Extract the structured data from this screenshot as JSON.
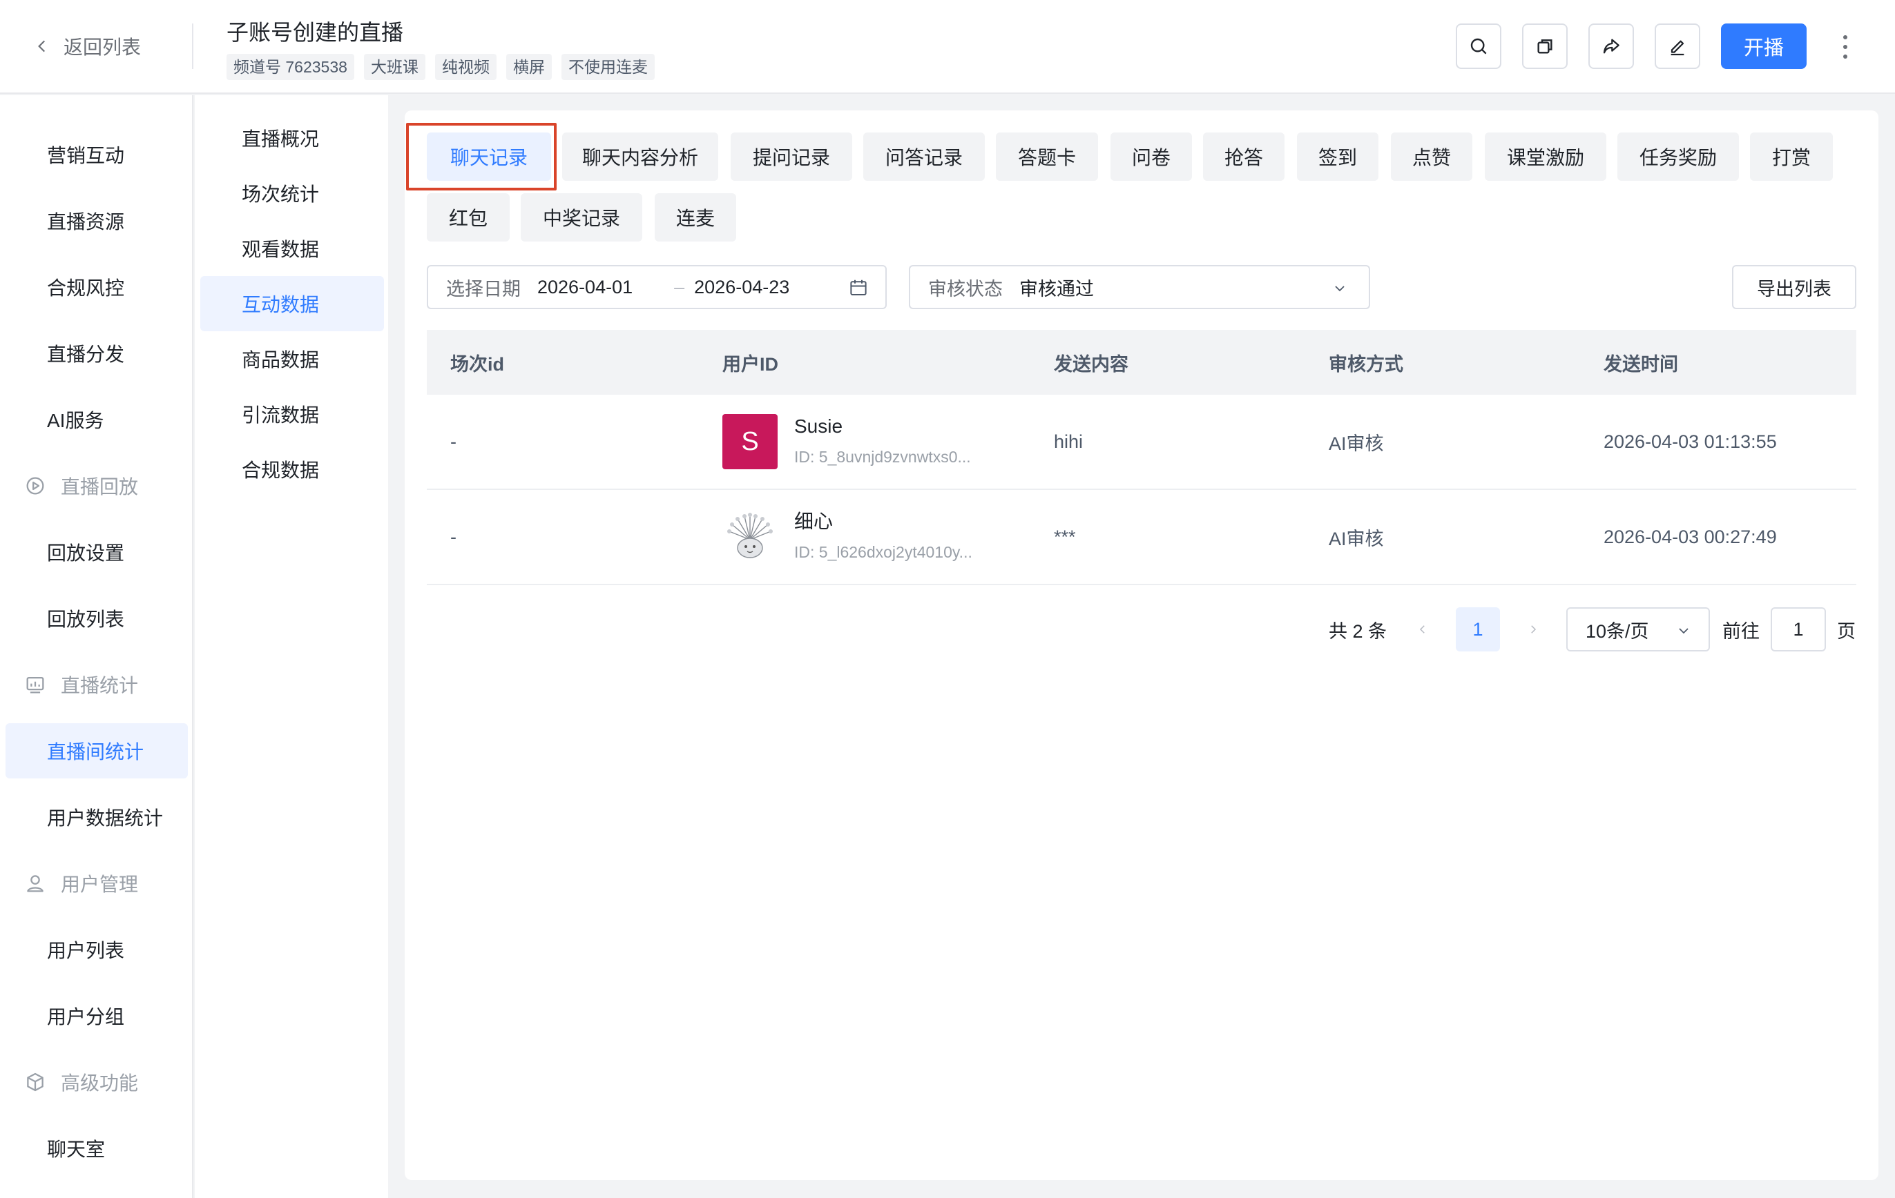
{
  "header": {
    "back_label": "返回列表",
    "title": "子账号创建的直播",
    "tags": [
      "频道号 7623538",
      "大班课",
      "纯视频",
      "横屏",
      "不使用连麦"
    ],
    "icons": [
      "search-icon",
      "copy-icon",
      "share-icon",
      "edit-icon"
    ],
    "live_button": "开播",
    "accent_color": "#2f7bff"
  },
  "nav_primary": {
    "items": [
      {
        "label": "营销互动",
        "kind": "item"
      },
      {
        "label": "直播资源",
        "kind": "item"
      },
      {
        "label": "合规风控",
        "kind": "item"
      },
      {
        "label": "直播分发",
        "kind": "item"
      },
      {
        "label": "AI服务",
        "kind": "item"
      },
      {
        "label": "直播回放",
        "kind": "group",
        "icon": "replay-icon"
      },
      {
        "label": "回放设置",
        "kind": "item"
      },
      {
        "label": "回放列表",
        "kind": "item"
      },
      {
        "label": "直播统计",
        "kind": "group",
        "icon": "stats-icon"
      },
      {
        "label": "直播间统计",
        "kind": "item",
        "active": true
      },
      {
        "label": "用户数据统计",
        "kind": "item"
      },
      {
        "label": "用户管理",
        "kind": "group",
        "icon": "user-icon"
      },
      {
        "label": "用户列表",
        "kind": "item"
      },
      {
        "label": "用户分组",
        "kind": "item"
      },
      {
        "label": "高级功能",
        "kind": "group",
        "icon": "cube-icon"
      },
      {
        "label": "聊天室",
        "kind": "item"
      }
    ]
  },
  "nav_secondary": {
    "items": [
      "直播概况",
      "场次统计",
      "观看数据",
      "互动数据",
      "商品数据",
      "引流数据",
      "合规数据"
    ],
    "active": "互动数据"
  },
  "tabs": {
    "row1": [
      "聊天记录",
      "聊天内容分析",
      "提问记录",
      "问答记录",
      "答题卡",
      "问卷",
      "抢答",
      "签到",
      "点赞",
      "课堂激励",
      "任务奖励",
      "打赏"
    ],
    "row2": [
      "红包",
      "中奖记录",
      "连麦"
    ],
    "active": "聊天记录"
  },
  "filters": {
    "date_label": "选择日期",
    "date_start": "2026-04-01",
    "date_sep": "–",
    "date_end": "2026-04-23",
    "status_label": "审核状态",
    "status_value": "审核通过",
    "export_label": "导出列表"
  },
  "table": {
    "columns": [
      "场次id",
      "用户ID",
      "发送内容",
      "审核方式",
      "发送时间"
    ],
    "rows": [
      {
        "session_id": "-",
        "avatar_letter": "S",
        "user_name": "Susie",
        "user_id": "ID: 5_8uvnjd9zvnwtxs0...",
        "content": "hihi",
        "review": "AI审核",
        "time": "2026-04-03 01:13:55"
      },
      {
        "session_id": "-",
        "avatar_letter": "",
        "user_name": "细心",
        "user_id": "ID: 5_l626dxoj2yt4010y...",
        "content": "***",
        "review": "AI审核",
        "time": "2026-04-03 00:27:49"
      }
    ]
  },
  "pagination": {
    "total": "共 2 条",
    "current_page": "1",
    "page_size": "10条/页",
    "goto_label": "前往",
    "goto_value": "1",
    "page_suffix": "页"
  }
}
